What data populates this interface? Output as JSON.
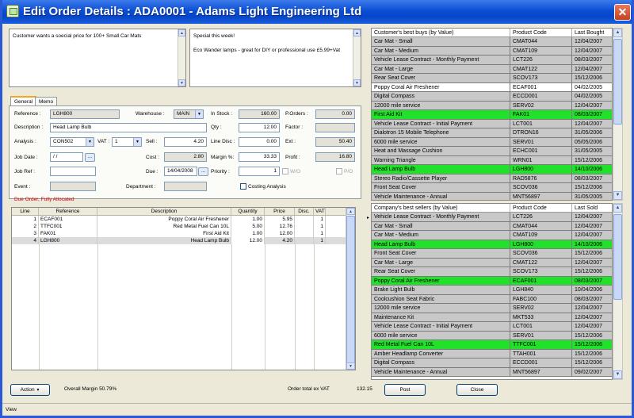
{
  "window": {
    "title": "Edit Order Details : ADA0001 - Adams Light Engineering Ltd",
    "close": "✕"
  },
  "notes": {
    "customer_note": "Customer wants a soecial price for 100+ Small Car Mats",
    "special_title": "Special this week!",
    "special_text": "Eco Wander lamps - great for DIY or professional use £5.99+Vat"
  },
  "tabs": [
    "General",
    "Memo"
  ],
  "form": {
    "reference_label": "Reference :",
    "reference": "LGH800",
    "warehouse_label": "Warehouse :",
    "warehouse": "MAIN",
    "in_stock_label": "In Stock :",
    "in_stock": "160.00",
    "porders_label": "P.Orders :",
    "porders": "0.00",
    "description_label": "Description :",
    "description": "Head Lamp Bulb",
    "qty_label": "Qty :",
    "qty": "12.00",
    "factor_label": "Factor :",
    "factor": "",
    "analysis_label": "Analysis :",
    "analysis": "CON502",
    "vat_label": "VAT :",
    "vat": "1",
    "sell_label": "Sell :",
    "sell": "4.20",
    "line_disc_label": "Line Disc :",
    "line_disc": "0.00",
    "ext_label": "Ext :",
    "ext": "50.40",
    "job_date_label": "Job Date :",
    "job_date": " / /",
    "cost_label": "Cost :",
    "cost": "2.80",
    "margin_label": "Margin %:",
    "margin": "33.33",
    "profit_label": "Profit :",
    "profit": "16.80",
    "job_ref_label": "Job Ref :",
    "job_ref": "",
    "due_label": "Due :",
    "due": "14/04/2008",
    "priority_label": "Priority :",
    "priority": "1",
    "wo_label": "W/O",
    "po_label": "P/O",
    "event_label": "Event :",
    "event": "",
    "department_label": "Department :",
    "department": "",
    "costing_label": "Costing Analysis",
    "dots": "...",
    "status_text": "Due Order, Fully Allocated"
  },
  "lines": {
    "headers": [
      "Line",
      "Reference",
      "Description",
      "Quantity",
      "Price",
      "Disc.",
      "VAT"
    ],
    "rows": [
      [
        "1",
        "ECAF001",
        "Poppy Coral Air Freshener",
        "1.00",
        "5.95",
        "",
        "1"
      ],
      [
        "2",
        "TTFC001",
        "Red Metal Fuel Can 10L",
        "5.00",
        "12.76",
        "",
        "1"
      ],
      [
        "3",
        "FAK01",
        "First Aid Kit",
        "1.00",
        "12.00",
        "",
        "1"
      ],
      [
        "4",
        "LGH800",
        "Head Lamp Bulb",
        "12.00",
        "4.20",
        "",
        "1"
      ]
    ]
  },
  "customer_best_buys": {
    "headers": [
      "Customer's best buys (by Value)",
      "Product Code",
      "Last Bought"
    ],
    "rows": [
      {
        "name": "Car Mat - Small",
        "code": "CMAT044",
        "date": "12/04/2007",
        "style": "gray"
      },
      {
        "name": "Car Mat - Medium",
        "code": "CMAT109",
        "date": "12/04/2007",
        "style": "gray"
      },
      {
        "name": "Vehicle Lease Contract - Monthly Payment",
        "code": "LCT226",
        "date": "08/03/2007",
        "style": "gray"
      },
      {
        "name": "Car Mat - Large",
        "code": "CMAT122",
        "date": "12/04/2007",
        "style": "gray"
      },
      {
        "name": "Rear Seat Cover",
        "code": "SCOV173",
        "date": "15/12/2006",
        "style": "gray"
      },
      {
        "name": "Poppy Coral Air Freshener",
        "code": "ECAF001",
        "date": "04/02/2005",
        "style": "white"
      },
      {
        "name": "Digital Compass",
        "code": "ECCD001",
        "date": "04/02/2005",
        "style": "gray"
      },
      {
        "name": "12000 mile service",
        "code": "SERV02",
        "date": "12/04/2007",
        "style": "gray"
      },
      {
        "name": "First Aid Kit",
        "code": "FAK01",
        "date": "08/03/2007",
        "style": "green"
      },
      {
        "name": "Vehicle Lease Contract - Initial Payment",
        "code": "LCT001",
        "date": "12/04/2007",
        "style": "gray"
      },
      {
        "name": "Dialotron 15 Mobile Telephone",
        "code": "DTRON16",
        "date": "31/05/2006",
        "style": "gray"
      },
      {
        "name": "6000 mile service",
        "code": "SERV01",
        "date": "05/05/2006",
        "style": "gray"
      },
      {
        "name": "Heat and Massage Cushion",
        "code": "ECHC001",
        "date": "31/05/2005",
        "style": "gray"
      },
      {
        "name": "Warning Triangle",
        "code": "WRN01",
        "date": "15/12/2006",
        "style": "gray"
      },
      {
        "name": "Head Lamp Bulb",
        "code": "LGH800",
        "date": "14/10/2006",
        "style": "green"
      },
      {
        "name": "Stereo Radio/Cassette Player",
        "code": "RAD5876",
        "date": "08/03/2007",
        "style": "gray"
      },
      {
        "name": "Front Seat Cover",
        "code": "SCOV036",
        "date": "15/12/2006",
        "style": "gray"
      },
      {
        "name": "Vehicle Maintenance - Annual",
        "code": "MNT56897",
        "date": "31/05/2005",
        "style": "gray"
      }
    ]
  },
  "company_best_sellers": {
    "headers": [
      "Company's best sellers (by Value)",
      "Product Code",
      "Last Sold"
    ],
    "rows": [
      {
        "name": "Vehicle Lease Contract - Monthly Payment",
        "code": "LCT226",
        "date": "12/04/2007",
        "style": "gray"
      },
      {
        "name": "Car Mat - Small",
        "code": "CMAT044",
        "date": "12/04/2007",
        "style": "gray"
      },
      {
        "name": "Car Mat - Medium",
        "code": "CMAT109",
        "date": "12/04/2007",
        "style": "gray"
      },
      {
        "name": "Head Lamp Bulb",
        "code": "LGH800",
        "date": "14/10/2006",
        "style": "green"
      },
      {
        "name": "Front Seat Cover",
        "code": "SCOV036",
        "date": "15/12/2006",
        "style": "gray"
      },
      {
        "name": "Car Mat - Large",
        "code": "CMAT122",
        "date": "12/04/2007",
        "style": "gray"
      },
      {
        "name": "Rear Seat Cover",
        "code": "SCOV173",
        "date": "15/12/2006",
        "style": "gray"
      },
      {
        "name": "Poppy Coral Air Freshener",
        "code": "ECAF001",
        "date": "08/03/2007",
        "style": "green"
      },
      {
        "name": "Brake Light Bulb",
        "code": "LGH840",
        "date": "10/04/2006",
        "style": "gray"
      },
      {
        "name": "Coolcushion Seat Fabric",
        "code": "FABC100",
        "date": "08/03/2007",
        "style": "gray"
      },
      {
        "name": "12000 mile service",
        "code": "SERV02",
        "date": "12/04/2007",
        "style": "gray"
      },
      {
        "name": "Maintenance Kit",
        "code": "MKT533",
        "date": "12/04/2007",
        "style": "gray"
      },
      {
        "name": "Vehicle Lease Contract - Initial Payment",
        "code": "LCT001",
        "date": "12/04/2007",
        "style": "gray"
      },
      {
        "name": "6000 mile service",
        "code": "SERV01",
        "date": "15/12/2006",
        "style": "gray"
      },
      {
        "name": "Red Metal Fuel Can 10L",
        "code": "TTFC001",
        "date": "15/12/2006",
        "style": "green"
      },
      {
        "name": "Amber Headlamp Converter",
        "code": "TTAH001",
        "date": "15/12/2006",
        "style": "gray"
      },
      {
        "name": "Digital Compass",
        "code": "ECCD001",
        "date": "15/12/2006",
        "style": "gray"
      },
      {
        "name": "Vehicle Maintenance - Annual",
        "code": "MNT56897",
        "date": "09/02/2007",
        "style": "gray"
      }
    ]
  },
  "footer": {
    "action_label": "Action",
    "overall_margin_label": "Overall Margin 50.79%",
    "order_total_label": "Order total ex VAT",
    "order_total": "132.15",
    "post_label": "Post",
    "close_label": "Close",
    "status_text": "View"
  },
  "colors": {
    "title_bar": "#0a4ed6",
    "highlight_green": "#22e12a",
    "row_gray": "#c8c8c8",
    "status_red": "#d40000"
  }
}
